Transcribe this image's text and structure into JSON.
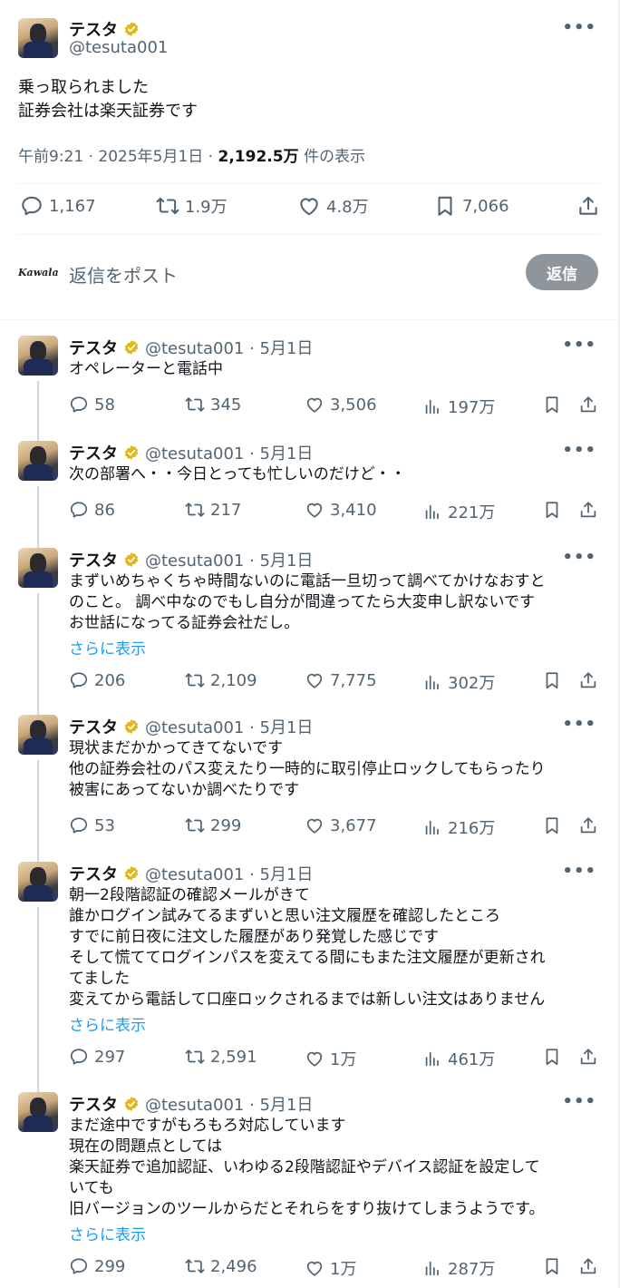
{
  "main": {
    "name": "テスタ",
    "handle": "@tesuta001",
    "text_line1": "乗っ取られました",
    "text_line2": "証券会社は楽天証券です",
    "time": "午前9:21 · 2025年5月1日 · ",
    "views_count": "2,192.5万",
    "views_label": " 件の表示",
    "actions": {
      "replies": "1,167",
      "reposts": "1.9万",
      "likes": "4.8万",
      "bookmarks": "7,066"
    },
    "reply_logo": "Kawala",
    "reply_placeholder": "返信をポスト",
    "reply_button": "返信"
  },
  "replies": [
    {
      "name": "テスタ",
      "handle": "@tesuta001 · 5月1日",
      "text": "オペレーターと電話中",
      "more": "",
      "replies": "58",
      "reposts": "345",
      "likes": "3,506",
      "views": "197万"
    },
    {
      "name": "テスタ",
      "handle": "@tesuta001 · 5月1日",
      "text": "次の部署へ・・今日とっても忙しいのだけど・・",
      "more": "",
      "replies": "86",
      "reposts": "217",
      "likes": "3,410",
      "views": "221万"
    },
    {
      "name": "テスタ",
      "handle": "@tesuta001 · 5月1日",
      "text": "まずいめちゃくちゃ時間ないのに電話一旦切って調べてかけなおすと\nのこと。 調べ中なのでもし自分が間違ってたら大変申し訳ないです\nお世話になってる証券会社だし。",
      "more": "さらに表示",
      "replies": "206",
      "reposts": "2,109",
      "likes": "7,775",
      "views": "302万"
    },
    {
      "name": "テスタ",
      "handle": "@tesuta001 · 5月1日",
      "text": "現状まだかかってきてないです\n他の証券会社のパス変えたり一時的に取引停止ロックしてもらったり\n被害にあってないか調べたりです",
      "more": "",
      "replies": "53",
      "reposts": "299",
      "likes": "3,677",
      "views": "216万"
    },
    {
      "name": "テスタ",
      "handle": "@tesuta001 · 5月1日",
      "text": "朝一2段階認証の確認メールがきて\n誰かログイン試みてるまずいと思い注文履歴を確認したところ\nすでに前日夜に注文した履歴があり発覚した感じです\nそして慌ててログインパスを変えてる間にもまた注文履歴が更新され\nてました\n変えてから電話して口座ロックされるまでは新しい注文はありません",
      "more": "さらに表示",
      "replies": "297",
      "reposts": "2,591",
      "likes": "1万",
      "views": "461万"
    },
    {
      "name": "テスタ",
      "handle": "@tesuta001 · 5月1日",
      "text": "まだ途中ですがもろもろ対応しています\n現在の問題点としては\n楽天証券で追加認証、いわゆる2段階認証やデバイス認証を設定して\nいても\n旧バージョンのツールからだとそれらをすり抜けてしまうようです。",
      "more": "さらに表示",
      "replies": "299",
      "reposts": "2,496",
      "likes": "1万",
      "views": "287万"
    }
  ],
  "icons": {
    "reply": "speech-bubble-icon",
    "repost": "repost-arrows-icon",
    "like": "heart-icon",
    "views": "bar-chart-icon",
    "bookmark": "bookmark-icon",
    "share": "share-upload-icon",
    "more": "more-dots-icon",
    "verified": "verified-badge-icon"
  },
  "colors": {
    "link": "#1d9bf0",
    "muted": "#536471",
    "verified": "#e2b719",
    "reply_button": "#8e969c"
  }
}
